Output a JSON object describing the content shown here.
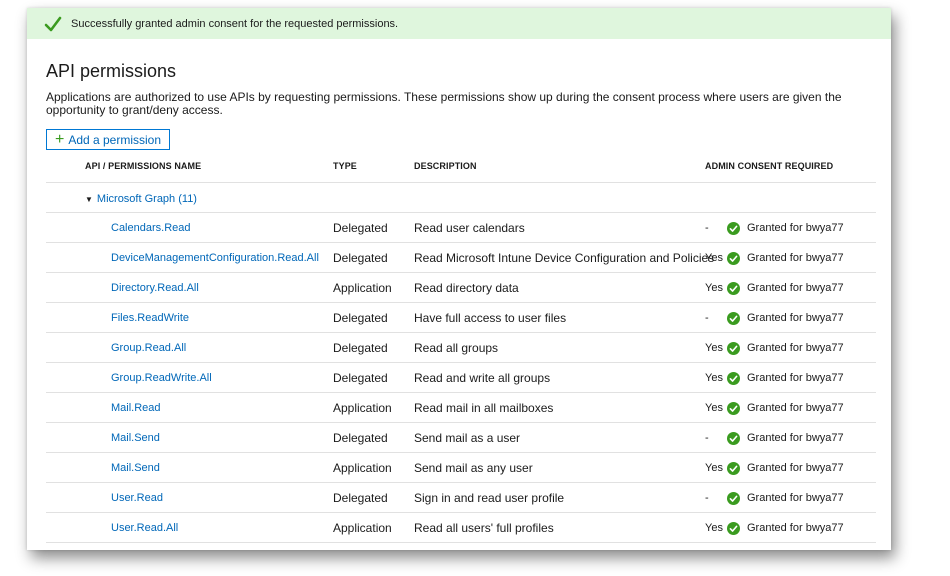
{
  "banner": {
    "message": "Successfully granted admin consent for the requested permissions.",
    "icon": "checkmark-icon",
    "color": "#dff6dd"
  },
  "page": {
    "title": "API permissions",
    "description": "Applications are authorized to use APIs by requesting permissions. These permissions show up during the consent process where users are given the opportunity to grant/deny access."
  },
  "add_button": {
    "label": "Add a permission",
    "icon": "plus-icon"
  },
  "table": {
    "headers": {
      "name": "API / PERMISSIONS NAME",
      "type": "TYPE",
      "description": "DESCRIPTION",
      "admin": "ADMIN CONSENT REQUIRED"
    },
    "group": {
      "label": "Microsoft Graph (11)",
      "expanded": true
    },
    "rows": [
      {
        "name": "Calendars.Read",
        "type": "Delegated",
        "description": "Read user calendars",
        "admin": "-",
        "status": "Granted for bwya77"
      },
      {
        "name": "DeviceManagementConfiguration.Read.All",
        "type": "Delegated",
        "description": "Read Microsoft Intune Device Configuration and Policies",
        "admin": "Yes",
        "status": "Granted for bwya77"
      },
      {
        "name": "Directory.Read.All",
        "type": "Application",
        "description": "Read directory data",
        "admin": "Yes",
        "status": "Granted for bwya77"
      },
      {
        "name": "Files.ReadWrite",
        "type": "Delegated",
        "description": "Have full access to user files",
        "admin": "-",
        "status": "Granted for bwya77"
      },
      {
        "name": "Group.Read.All",
        "type": "Delegated",
        "description": "Read all groups",
        "admin": "Yes",
        "status": "Granted for bwya77"
      },
      {
        "name": "Group.ReadWrite.All",
        "type": "Delegated",
        "description": "Read and write all groups",
        "admin": "Yes",
        "status": "Granted for bwya77"
      },
      {
        "name": "Mail.Read",
        "type": "Application",
        "description": "Read mail in all mailboxes",
        "admin": "Yes",
        "status": "Granted for bwya77"
      },
      {
        "name": "Mail.Send",
        "type": "Delegated",
        "description": "Send mail as a user",
        "admin": "-",
        "status": "Granted for bwya77"
      },
      {
        "name": "Mail.Send",
        "type": "Application",
        "description": "Send mail as any user",
        "admin": "Yes",
        "status": "Granted for bwya77"
      },
      {
        "name": "User.Read",
        "type": "Delegated",
        "description": "Sign in and read user profile",
        "admin": "-",
        "status": "Granted for bwya77"
      },
      {
        "name": "User.Read.All",
        "type": "Application",
        "description": "Read all users' full profiles",
        "admin": "Yes",
        "status": "Granted for bwya77"
      }
    ]
  },
  "colors": {
    "link": "#0067b8",
    "success": "#3a9b1f",
    "border": "#e1e1e1"
  }
}
